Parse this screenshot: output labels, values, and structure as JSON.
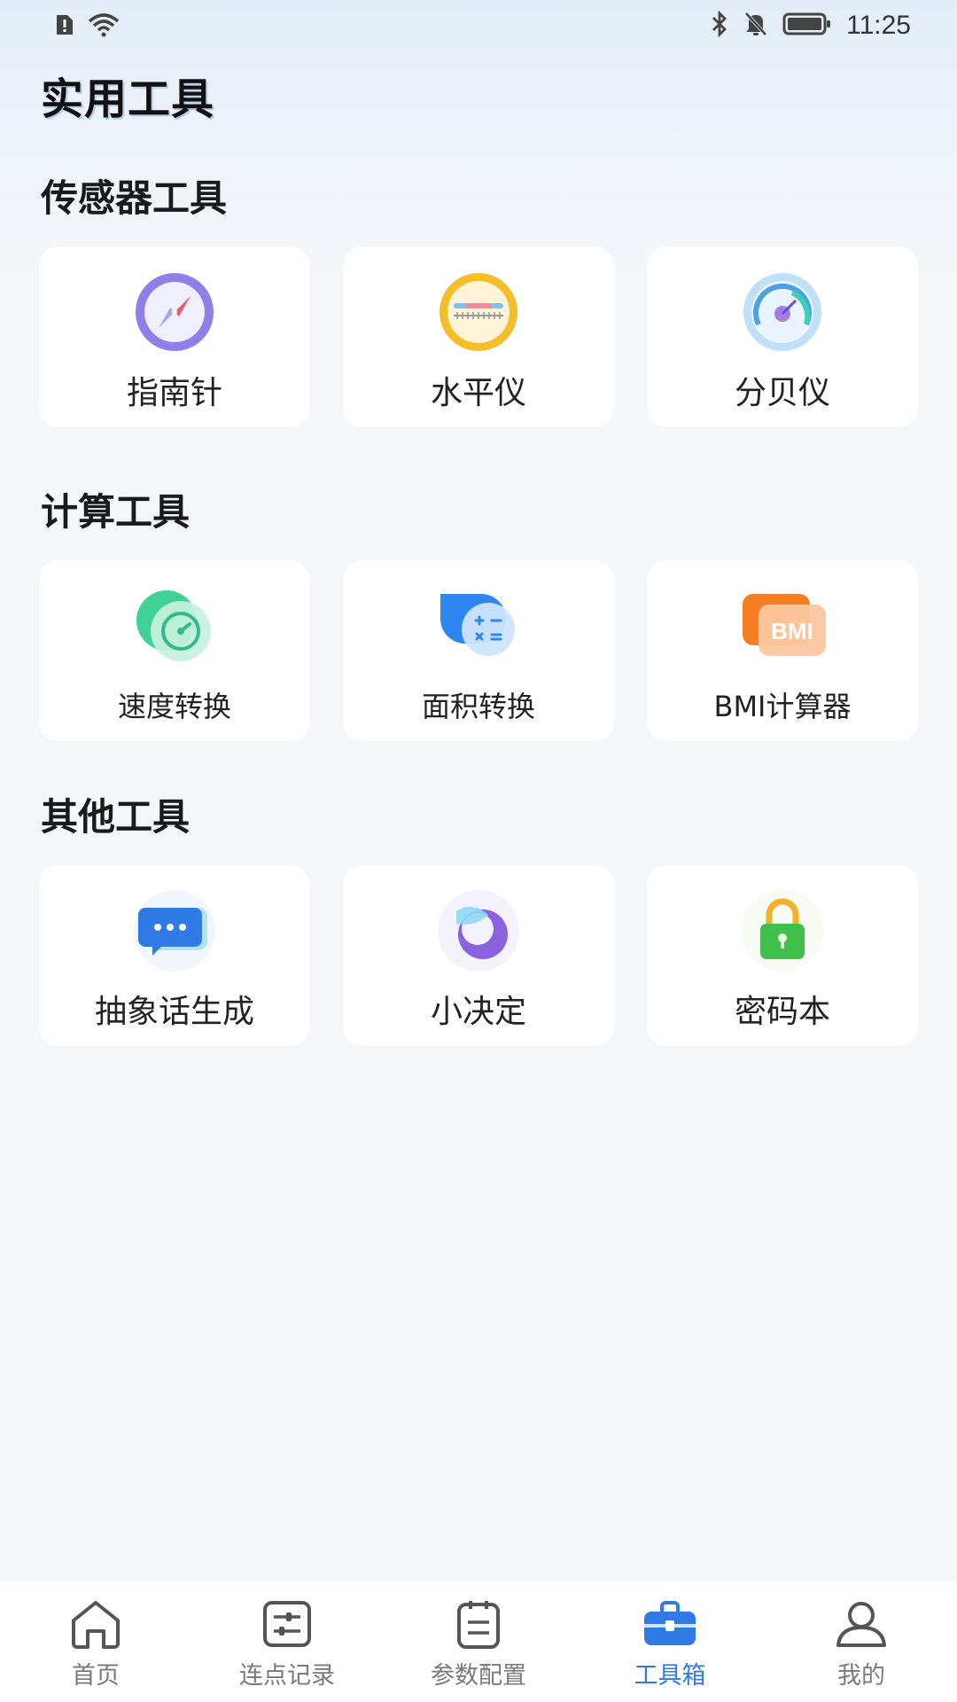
{
  "status_bar": {
    "time": "11:25",
    "left_icons": [
      "sim-alert-icon",
      "wifi-icon"
    ],
    "right_icons": [
      "bluetooth-icon",
      "mute-bell-icon",
      "battery-icon"
    ]
  },
  "page_title": "实用工具",
  "sections": [
    {
      "title": "传感器工具",
      "items": [
        {
          "label": "指南针",
          "icon": "compass-icon"
        },
        {
          "label": "水平仪",
          "icon": "level-icon"
        },
        {
          "label": "分贝仪",
          "icon": "decibel-meter-icon"
        }
      ]
    },
    {
      "title": "计算工具",
      "items": [
        {
          "label": "速度转换",
          "icon": "speedometer-icon"
        },
        {
          "label": "面积转换",
          "icon": "calculator-icon"
        },
        {
          "label": "BMI计算器",
          "icon": "bmi-icon",
          "icon_text": "BMI"
        }
      ]
    },
    {
      "title": "其他工具",
      "items": [
        {
          "label": "抽象话生成",
          "icon": "chat-bubble-icon"
        },
        {
          "label": "小决定",
          "icon": "moon-disc-icon"
        },
        {
          "label": "密码本",
          "icon": "lock-icon"
        }
      ]
    }
  ],
  "tabbar": {
    "active_index": 3,
    "accent_color": "#2f7ae5",
    "items": [
      {
        "label": "首页",
        "icon": "home-icon"
      },
      {
        "label": "连点记录",
        "icon": "sliders-icon"
      },
      {
        "label": "参数配置",
        "icon": "clipboard-icon"
      },
      {
        "label": "工具箱",
        "icon": "toolbox-icon"
      },
      {
        "label": "我的",
        "icon": "user-icon"
      }
    ]
  }
}
